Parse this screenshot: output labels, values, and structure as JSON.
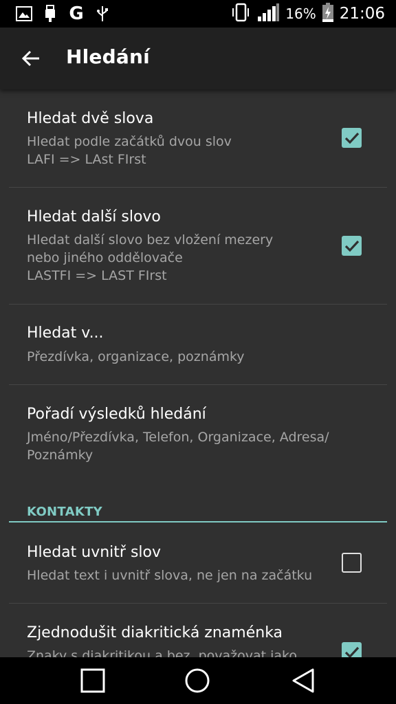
{
  "status_bar": {
    "icons_left": [
      "image-icon",
      "usb-icon",
      "google-icon",
      "usb-debug-icon"
    ],
    "google_glyph": "G",
    "battery_percent": "16%",
    "clock": "21:06"
  },
  "app_bar": {
    "title": "Hledání"
  },
  "prefs": {
    "two_words": {
      "title": "Hledat dvě slova",
      "summary_1": "Hledat podle začátků dvou slov",
      "summary_2": "LAFI => LAst FIrst",
      "checked": true
    },
    "next_word": {
      "title": "Hledat další slovo",
      "summary_1": "Hledat další slovo bez vložení mezery",
      "summary_2": "nebo jiného oddělovače",
      "summary_3": "LASTFI => LAST FIrst",
      "checked": true
    },
    "search_in": {
      "title": "Hledat v...",
      "summary_1": "Přezdívka, organizace, poznámky"
    },
    "result_order": {
      "title": "Pořadí výsledků hledání",
      "summary_1": "Jméno/Přezdívka, Telefon, Organizace, Adresa/",
      "summary_2": "Poznámky"
    }
  },
  "category": {
    "title": "KONTAKTY"
  },
  "contacts_prefs": {
    "inside_words": {
      "title": "Hledat uvnitř slov",
      "summary_1": "Hledat text i uvnitř slova, ne jen na začátku",
      "checked": false
    },
    "simplify_diacritics": {
      "title": "Zjednodušit diakritická znaménka",
      "summary_1": "Znaky s diakritikou a bez, považovat jako",
      "checked": true
    }
  },
  "nav_bar": {
    "buttons": [
      "recents-square-icon",
      "home-circle-icon",
      "back-triangle-icon"
    ]
  },
  "colors": {
    "accent": "#80cbc4",
    "background": "#303030",
    "app_bar": "#212121"
  }
}
